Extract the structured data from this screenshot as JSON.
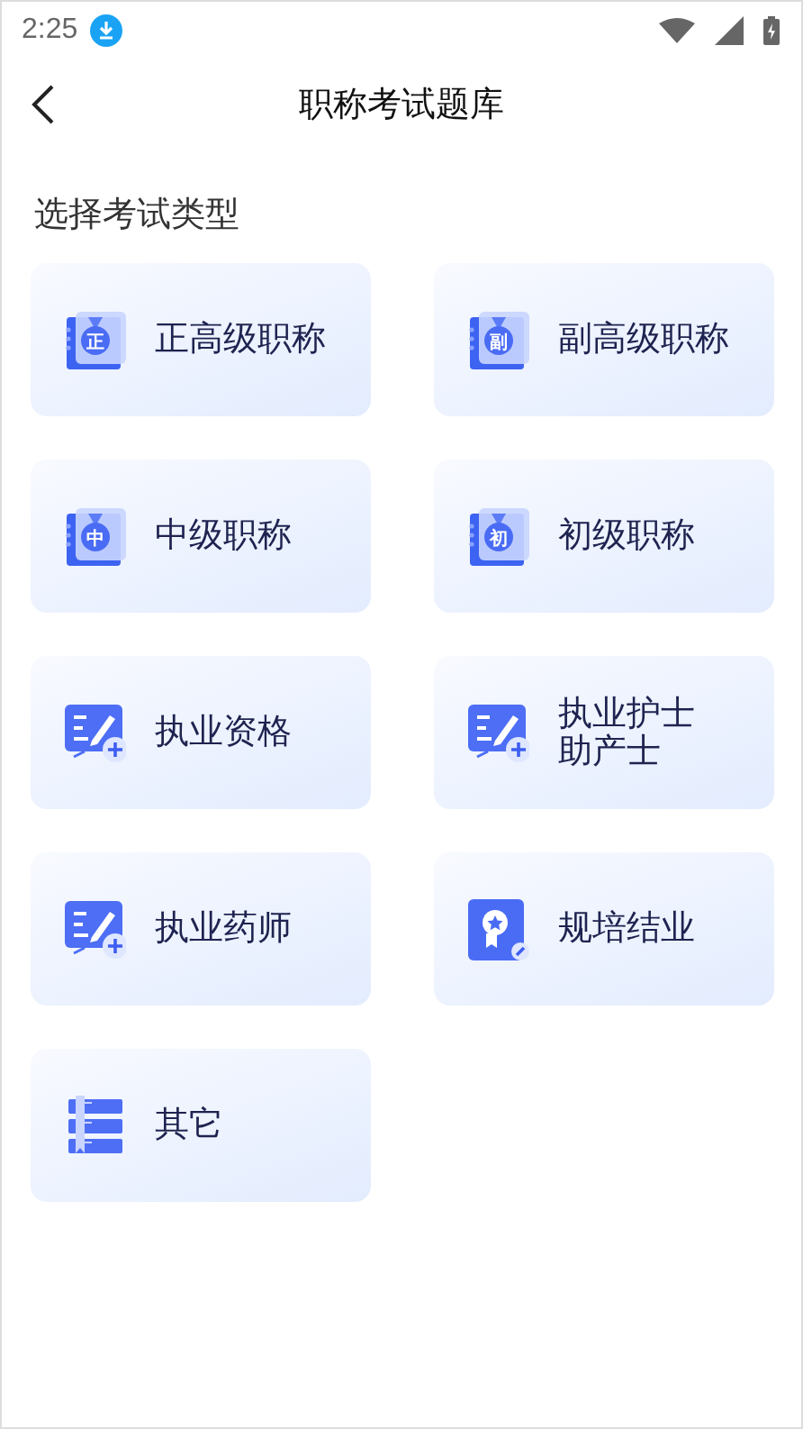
{
  "status_bar": {
    "time": "2:25"
  },
  "header": {
    "title": "职称考试题库"
  },
  "section_title": "选择考试类型",
  "categories": [
    {
      "lines": [
        "正高级职称"
      ],
      "kind": "medal",
      "badge": "正"
    },
    {
      "lines": [
        "副高级职称"
      ],
      "kind": "medal",
      "badge": "副"
    },
    {
      "lines": [
        "中级职称"
      ],
      "kind": "medal",
      "badge": "中"
    },
    {
      "lines": [
        "初级职称"
      ],
      "kind": "medal",
      "badge": "初"
    },
    {
      "lines": [
        "执业资格"
      ],
      "kind": "form"
    },
    {
      "lines": [
        "执业护士",
        "助产士"
      ],
      "kind": "form"
    },
    {
      "lines": [
        "执业药师"
      ],
      "kind": "form"
    },
    {
      "lines": [
        "规培结业"
      ],
      "kind": "certificate"
    },
    {
      "lines": [
        "其它"
      ],
      "kind": "books"
    }
  ]
}
